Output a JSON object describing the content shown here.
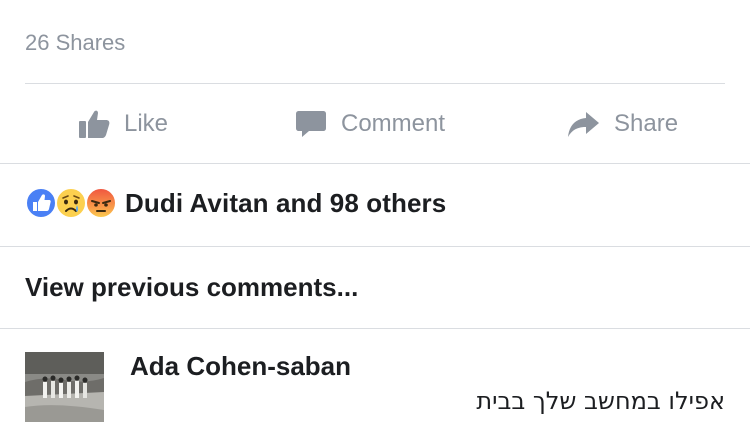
{
  "post": {
    "shares_text": "26 Shares"
  },
  "actions": {
    "like_label": "Like",
    "comment_label": "Comment",
    "share_label": "Share"
  },
  "reactions": {
    "icons": [
      "like-icon",
      "sad-icon",
      "angry-icon"
    ],
    "summary": "Dudi Avitan and 98 others"
  },
  "comments": {
    "view_previous_label": "View previous comments...",
    "items": [
      {
        "author": "Ada Cohen-saban",
        "text": "אפילו במחשב שלך בבית"
      }
    ]
  },
  "colors": {
    "muted_text": "#8d949e",
    "primary_text": "#1c1e21",
    "divider": "#dadde1",
    "like_blue": "#4a80f5",
    "angry_red": "#f0533f",
    "sad_yellow": "#fcd04f"
  }
}
